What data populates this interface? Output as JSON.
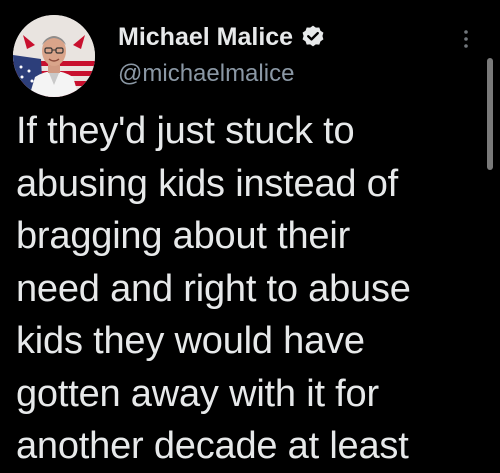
{
  "tweet": {
    "display_name": "Michael Malice",
    "handle": "@michaelmalice",
    "verified": true,
    "body": "If they'd just stuck to\nabusing kids instead of\nbragging about their\nneed and right to abuse\nkids they would have\ngotten away with it for\nanother decade at least"
  },
  "icons": {
    "avatar": "user-avatar-photo",
    "verified": "verified-badge-icon",
    "more": "more-options-icon"
  },
  "colors": {
    "background": "#000000",
    "text": "#e7e9ea",
    "secondary_text": "#8b98a5",
    "verified_badge": "#e7e9ea"
  }
}
